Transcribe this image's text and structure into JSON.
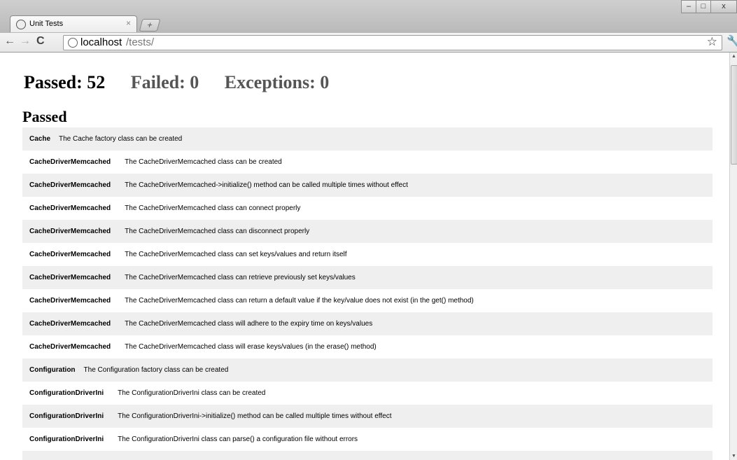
{
  "tab": {
    "title": "Unit Tests",
    "close": "×",
    "newtab": "+"
  },
  "window": {
    "minimize": "–",
    "maximize": "□",
    "close": "x"
  },
  "toolbar": {
    "back": "←",
    "forward": "→",
    "reload": "C",
    "wrench": "🔧",
    "star": "☆"
  },
  "omnibox": {
    "host": "localhost",
    "path": "/tests/"
  },
  "summary": {
    "passed": "Passed: 52",
    "failed": "Failed: 0",
    "exceptions": "Exceptions: 0"
  },
  "section_title": "Passed",
  "rows": [
    {
      "cls": "Cache",
      "desc": "The Cache factory class can be created"
    },
    {
      "cls": "CacheDriverMemcached",
      "desc": "The CacheDriverMemcached class can be created"
    },
    {
      "cls": "CacheDriverMemcached",
      "desc": "The CacheDriverMemcached->initialize() method can be called multiple times without effect"
    },
    {
      "cls": "CacheDriverMemcached",
      "desc": "The CacheDriverMemcached class can connect properly"
    },
    {
      "cls": "CacheDriverMemcached",
      "desc": "The CacheDriverMemcached class can disconnect properly"
    },
    {
      "cls": "CacheDriverMemcached",
      "desc": "The CacheDriverMemcached class can set keys/values and return itself"
    },
    {
      "cls": "CacheDriverMemcached",
      "desc": "The CacheDriverMemcached class can retrieve previously set keys/values"
    },
    {
      "cls": "CacheDriverMemcached",
      "desc": "The CacheDriverMemcached class can return a default value if the key/value does not exist (in the get() method)"
    },
    {
      "cls": "CacheDriverMemcached",
      "desc": "The CacheDriverMemcached class will adhere to the expiry time on keys/values"
    },
    {
      "cls": "CacheDriverMemcached",
      "desc": "The CacheDriverMemcached class will erase keys/values (in the erase() method)"
    },
    {
      "cls": "Configuration",
      "desc": "The Configuration factory class can be created"
    },
    {
      "cls": "ConfigurationDriverIni",
      "desc": "The ConfigurationDriverIni class can be created"
    },
    {
      "cls": "ConfigurationDriverIni",
      "desc": "The ConfigurationDriverIni->initialize() method can be called multiple times without effect"
    },
    {
      "cls": "ConfigurationDriverIni",
      "desc": "The ConfigurationDriverIni class can parse() a configuration file without errors"
    },
    {
      "cls": "",
      "desc": ""
    }
  ]
}
